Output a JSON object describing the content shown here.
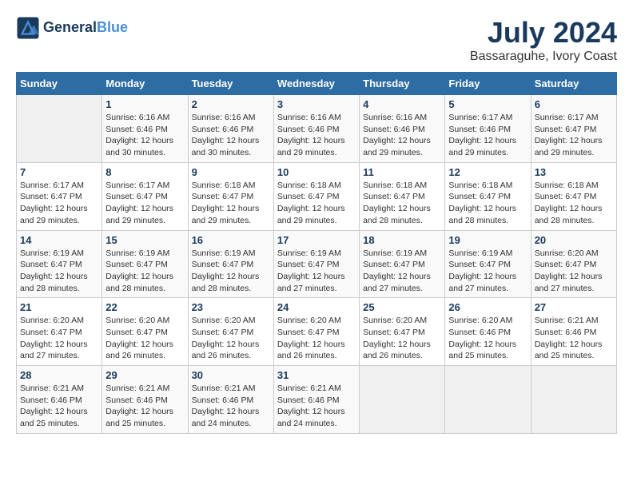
{
  "header": {
    "logo_line1": "General",
    "logo_line2": "Blue",
    "month_title": "July 2024",
    "location": "Bassaraguhe, Ivory Coast"
  },
  "days_of_week": [
    "Sunday",
    "Monday",
    "Tuesday",
    "Wednesday",
    "Thursday",
    "Friday",
    "Saturday"
  ],
  "weeks": [
    [
      {
        "day": "",
        "info": ""
      },
      {
        "day": "1",
        "info": "Sunrise: 6:16 AM\nSunset: 6:46 PM\nDaylight: 12 hours\nand 30 minutes."
      },
      {
        "day": "2",
        "info": "Sunrise: 6:16 AM\nSunset: 6:46 PM\nDaylight: 12 hours\nand 30 minutes."
      },
      {
        "day": "3",
        "info": "Sunrise: 6:16 AM\nSunset: 6:46 PM\nDaylight: 12 hours\nand 29 minutes."
      },
      {
        "day": "4",
        "info": "Sunrise: 6:16 AM\nSunset: 6:46 PM\nDaylight: 12 hours\nand 29 minutes."
      },
      {
        "day": "5",
        "info": "Sunrise: 6:17 AM\nSunset: 6:46 PM\nDaylight: 12 hours\nand 29 minutes."
      },
      {
        "day": "6",
        "info": "Sunrise: 6:17 AM\nSunset: 6:47 PM\nDaylight: 12 hours\nand 29 minutes."
      }
    ],
    [
      {
        "day": "7",
        "info": "Sunrise: 6:17 AM\nSunset: 6:47 PM\nDaylight: 12 hours\nand 29 minutes."
      },
      {
        "day": "8",
        "info": "Sunrise: 6:17 AM\nSunset: 6:47 PM\nDaylight: 12 hours\nand 29 minutes."
      },
      {
        "day": "9",
        "info": "Sunrise: 6:18 AM\nSunset: 6:47 PM\nDaylight: 12 hours\nand 29 minutes."
      },
      {
        "day": "10",
        "info": "Sunrise: 6:18 AM\nSunset: 6:47 PM\nDaylight: 12 hours\nand 29 minutes."
      },
      {
        "day": "11",
        "info": "Sunrise: 6:18 AM\nSunset: 6:47 PM\nDaylight: 12 hours\nand 28 minutes."
      },
      {
        "day": "12",
        "info": "Sunrise: 6:18 AM\nSunset: 6:47 PM\nDaylight: 12 hours\nand 28 minutes."
      },
      {
        "day": "13",
        "info": "Sunrise: 6:18 AM\nSunset: 6:47 PM\nDaylight: 12 hours\nand 28 minutes."
      }
    ],
    [
      {
        "day": "14",
        "info": "Sunrise: 6:19 AM\nSunset: 6:47 PM\nDaylight: 12 hours\nand 28 minutes."
      },
      {
        "day": "15",
        "info": "Sunrise: 6:19 AM\nSunset: 6:47 PM\nDaylight: 12 hours\nand 28 minutes."
      },
      {
        "day": "16",
        "info": "Sunrise: 6:19 AM\nSunset: 6:47 PM\nDaylight: 12 hours\nand 28 minutes."
      },
      {
        "day": "17",
        "info": "Sunrise: 6:19 AM\nSunset: 6:47 PM\nDaylight: 12 hours\nand 27 minutes."
      },
      {
        "day": "18",
        "info": "Sunrise: 6:19 AM\nSunset: 6:47 PM\nDaylight: 12 hours\nand 27 minutes."
      },
      {
        "day": "19",
        "info": "Sunrise: 6:19 AM\nSunset: 6:47 PM\nDaylight: 12 hours\nand 27 minutes."
      },
      {
        "day": "20",
        "info": "Sunrise: 6:20 AM\nSunset: 6:47 PM\nDaylight: 12 hours\nand 27 minutes."
      }
    ],
    [
      {
        "day": "21",
        "info": "Sunrise: 6:20 AM\nSunset: 6:47 PM\nDaylight: 12 hours\nand 27 minutes."
      },
      {
        "day": "22",
        "info": "Sunrise: 6:20 AM\nSunset: 6:47 PM\nDaylight: 12 hours\nand 26 minutes."
      },
      {
        "day": "23",
        "info": "Sunrise: 6:20 AM\nSunset: 6:47 PM\nDaylight: 12 hours\nand 26 minutes."
      },
      {
        "day": "24",
        "info": "Sunrise: 6:20 AM\nSunset: 6:47 PM\nDaylight: 12 hours\nand 26 minutes."
      },
      {
        "day": "25",
        "info": "Sunrise: 6:20 AM\nSunset: 6:47 PM\nDaylight: 12 hours\nand 26 minutes."
      },
      {
        "day": "26",
        "info": "Sunrise: 6:20 AM\nSunset: 6:46 PM\nDaylight: 12 hours\nand 25 minutes."
      },
      {
        "day": "27",
        "info": "Sunrise: 6:21 AM\nSunset: 6:46 PM\nDaylight: 12 hours\nand 25 minutes."
      }
    ],
    [
      {
        "day": "28",
        "info": "Sunrise: 6:21 AM\nSunset: 6:46 PM\nDaylight: 12 hours\nand 25 minutes."
      },
      {
        "day": "29",
        "info": "Sunrise: 6:21 AM\nSunset: 6:46 PM\nDaylight: 12 hours\nand 25 minutes."
      },
      {
        "day": "30",
        "info": "Sunrise: 6:21 AM\nSunset: 6:46 PM\nDaylight: 12 hours\nand 24 minutes."
      },
      {
        "day": "31",
        "info": "Sunrise: 6:21 AM\nSunset: 6:46 PM\nDaylight: 12 hours\nand 24 minutes."
      },
      {
        "day": "",
        "info": ""
      },
      {
        "day": "",
        "info": ""
      },
      {
        "day": "",
        "info": ""
      }
    ]
  ]
}
